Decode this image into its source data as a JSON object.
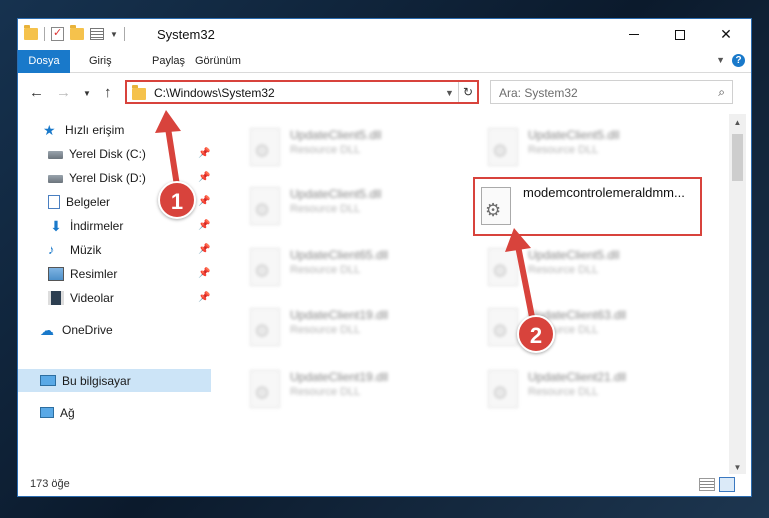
{
  "window": {
    "title": "System32",
    "status_count": "173 öğe"
  },
  "ribbon": {
    "tabs": [
      "Dosya",
      "Giriş",
      "Paylaş",
      "Görünüm"
    ]
  },
  "address": {
    "path": "C:\\Windows\\System32",
    "search_placeholder": "Ara: System32"
  },
  "sidebar": {
    "items": [
      {
        "label": "Hızlı erişim",
        "icon": "star-icon",
        "pinned": false
      },
      {
        "label": "Yerel Disk (C:)",
        "icon": "disk-icon",
        "pinned": true
      },
      {
        "label": "Yerel Disk (D:)",
        "icon": "disk-icon",
        "pinned": true
      },
      {
        "label": "Belgeler",
        "icon": "documents-icon",
        "pinned": true
      },
      {
        "label": "İndirmeler",
        "icon": "downloads-icon",
        "pinned": true
      },
      {
        "label": "Müzik",
        "icon": "music-icon",
        "pinned": true
      },
      {
        "label": "Resimler",
        "icon": "pictures-icon",
        "pinned": true
      },
      {
        "label": "Videolar",
        "icon": "videos-icon",
        "pinned": true
      },
      {
        "label": "OneDrive",
        "icon": "onedrive-icon",
        "pinned": false
      },
      {
        "label": "Bu bilgisayar",
        "icon": "this-pc-icon",
        "pinned": false,
        "selected": true
      },
      {
        "label": "Ağ",
        "icon": "network-icon",
        "pinned": false
      }
    ]
  },
  "files": [
    {
      "name": "UpdateClient5.dll",
      "type": "Resource DLL"
    },
    {
      "name": "UpdateClient5.dll",
      "type": "Resource DLL"
    },
    {
      "name": "UpdateClient5.dll",
      "type": "Resource DLL"
    },
    {
      "name": "modemcontrolemeraldmm...",
      "type": ""
    },
    {
      "name": "UpdateClient65.dll",
      "type": "Resource DLL"
    },
    {
      "name": "UpdateClient5.dll",
      "type": "Resource DLL"
    },
    {
      "name": "UpdateClient19.dll",
      "type": "Resource DLL"
    },
    {
      "name": "UpdateClient63.dll",
      "type": "Resource DLL"
    },
    {
      "name": "UpdateClient19.dll",
      "type": "Resource DLL"
    },
    {
      "name": "UpdateClient21.dll",
      "type": "Resource DLL"
    }
  ],
  "annotations": {
    "step1": "1",
    "step2": "2",
    "color": "#d8433c"
  }
}
